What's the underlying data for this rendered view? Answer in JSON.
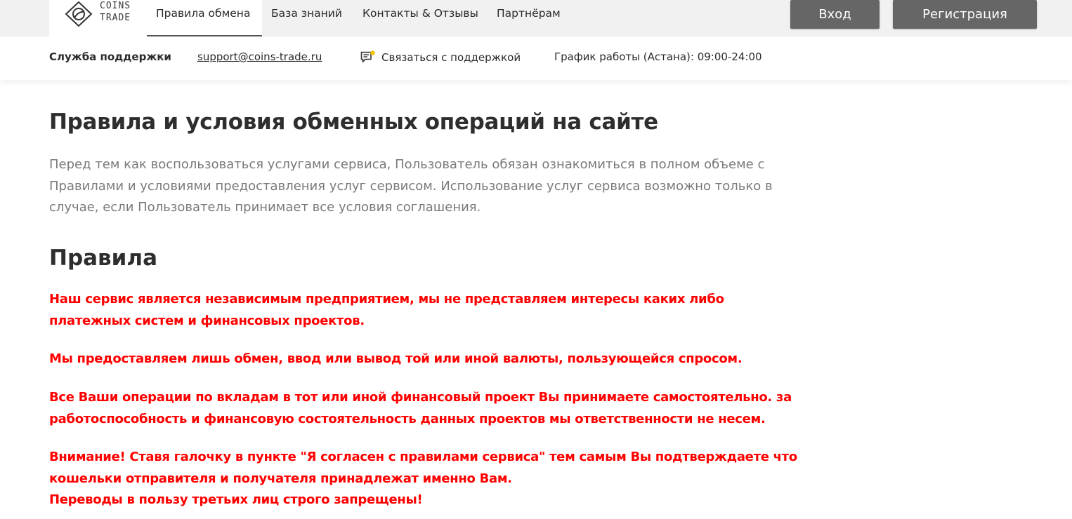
{
  "brand": {
    "logo_line1": "COINS",
    "logo_line2": "TRADE",
    "accent": "#ff0000",
    "button_bg": "#666666",
    "icon": "coins-trade-logo-icon"
  },
  "nav": {
    "items": [
      {
        "label": "Правила обмена",
        "active": true
      },
      {
        "label": "База знаний"
      },
      {
        "label": "Контакты & Отзывы"
      },
      {
        "label": "Партнёрам"
      }
    ],
    "login_label": "Вход",
    "register_label": "Регистрация"
  },
  "support": {
    "title": "Служба поддержки",
    "email": "support@coins-trade.ru",
    "contact_label": "Связаться с поддержкой",
    "contact_icon": "chat-icon",
    "schedule": "График работы (Астана): 09:00-24:00"
  },
  "main": {
    "title": "Правила и условия обменных операций на сайте",
    "intro": "Перед тем как воспользоваться услугами сервиса, Пользователь обязан ознакомиться в полном объеме с Правилами и условиями предоставления услуг сервисом. Использование услуг сервиса возможно только в случае, если Пользователь принимает все условия соглашения.",
    "rules_heading": "Правила",
    "rules": [
      {
        "lines": [
          "Наш сервис является независимым предприятием, мы не представляем интересы каких либо",
          "платежных систем и финансовых проектов."
        ]
      },
      {
        "lines": [
          "Мы предоставляем лишь обмен, ввод или вывод той или иной валюты, пользующейся спросом."
        ]
      },
      {
        "lines": [
          "Все Ваши операции по вкладам в тот или иной финансовый проект Вы принимаете самостоятельно. за",
          "работоспособность и финансовую состоятельность данных проектов мы ответственности не несем."
        ]
      },
      {
        "lines": [
          "Внимание! Ставя галочку в пункте \"Я согласен с правилами сервиса\" тем самым Вы подтверждаете что",
          "кошельки отправителя и получателя принадлежат именно Вам.",
          "Переводы в пользу третьих лиц строго запрещены!"
        ]
      }
    ]
  }
}
